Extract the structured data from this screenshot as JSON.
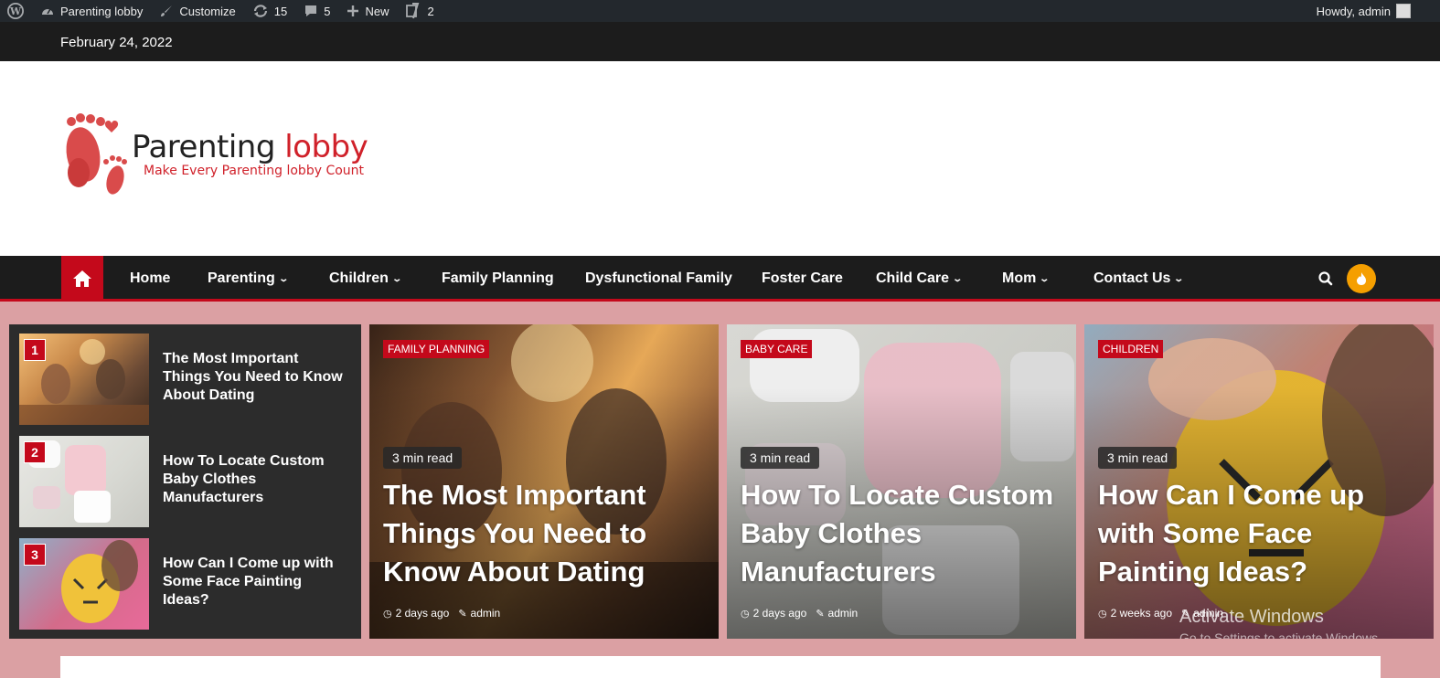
{
  "admin_bar": {
    "site_name": "Parenting lobby",
    "customize": "Customize",
    "updates": "15",
    "comments": "5",
    "new": "New",
    "yoast": "2",
    "howdy": "Howdy, admin"
  },
  "date": "February 24, 2022",
  "logo": {
    "title_part1": "Parenting",
    "title_part2": "lobby",
    "tagline": "Make Every Parenting lobby Count"
  },
  "nav": {
    "items": [
      {
        "label": "Home"
      },
      {
        "label": "Parenting"
      },
      {
        "label": "Children"
      },
      {
        "label": "Family Planning"
      },
      {
        "label": "Dysfunctional Family"
      },
      {
        "label": "Foster Care"
      },
      {
        "label": "Child Care"
      },
      {
        "label": "Mom"
      },
      {
        "label": "Contact Us"
      }
    ]
  },
  "trending": [
    {
      "num": "1",
      "title": "The Most Important Things You Need to Know About Dating"
    },
    {
      "num": "2",
      "title": "How To Locate Custom Baby Clothes Manufacturers"
    },
    {
      "num": "3",
      "title": "How Can I Come up with Some Face Painting Ideas?"
    }
  ],
  "cards": [
    {
      "category": "Family Planning",
      "read": "3 min read",
      "title": "The Most Important Things You Need to Know About Dating",
      "date": "2 days ago",
      "author": "admin"
    },
    {
      "category": "Baby Care",
      "read": "3 min read",
      "title": "How To Locate Custom Baby Clothes Manufacturers",
      "date": "2 days ago",
      "author": "admin"
    },
    {
      "category": "Children",
      "read": "3 min read",
      "title": "How Can I Come up with Some Face Painting Ideas?",
      "date": "2 weeks ago",
      "author": "admin"
    }
  ],
  "watermark": {
    "line1": "Activate Windows",
    "line2": "Go to Settings to activate Windows."
  },
  "colors": {
    "accent": "#c4091b",
    "page_bg": "#dba0a3",
    "bar_dark": "#1c1c1c",
    "bolt": "#f59f00"
  }
}
